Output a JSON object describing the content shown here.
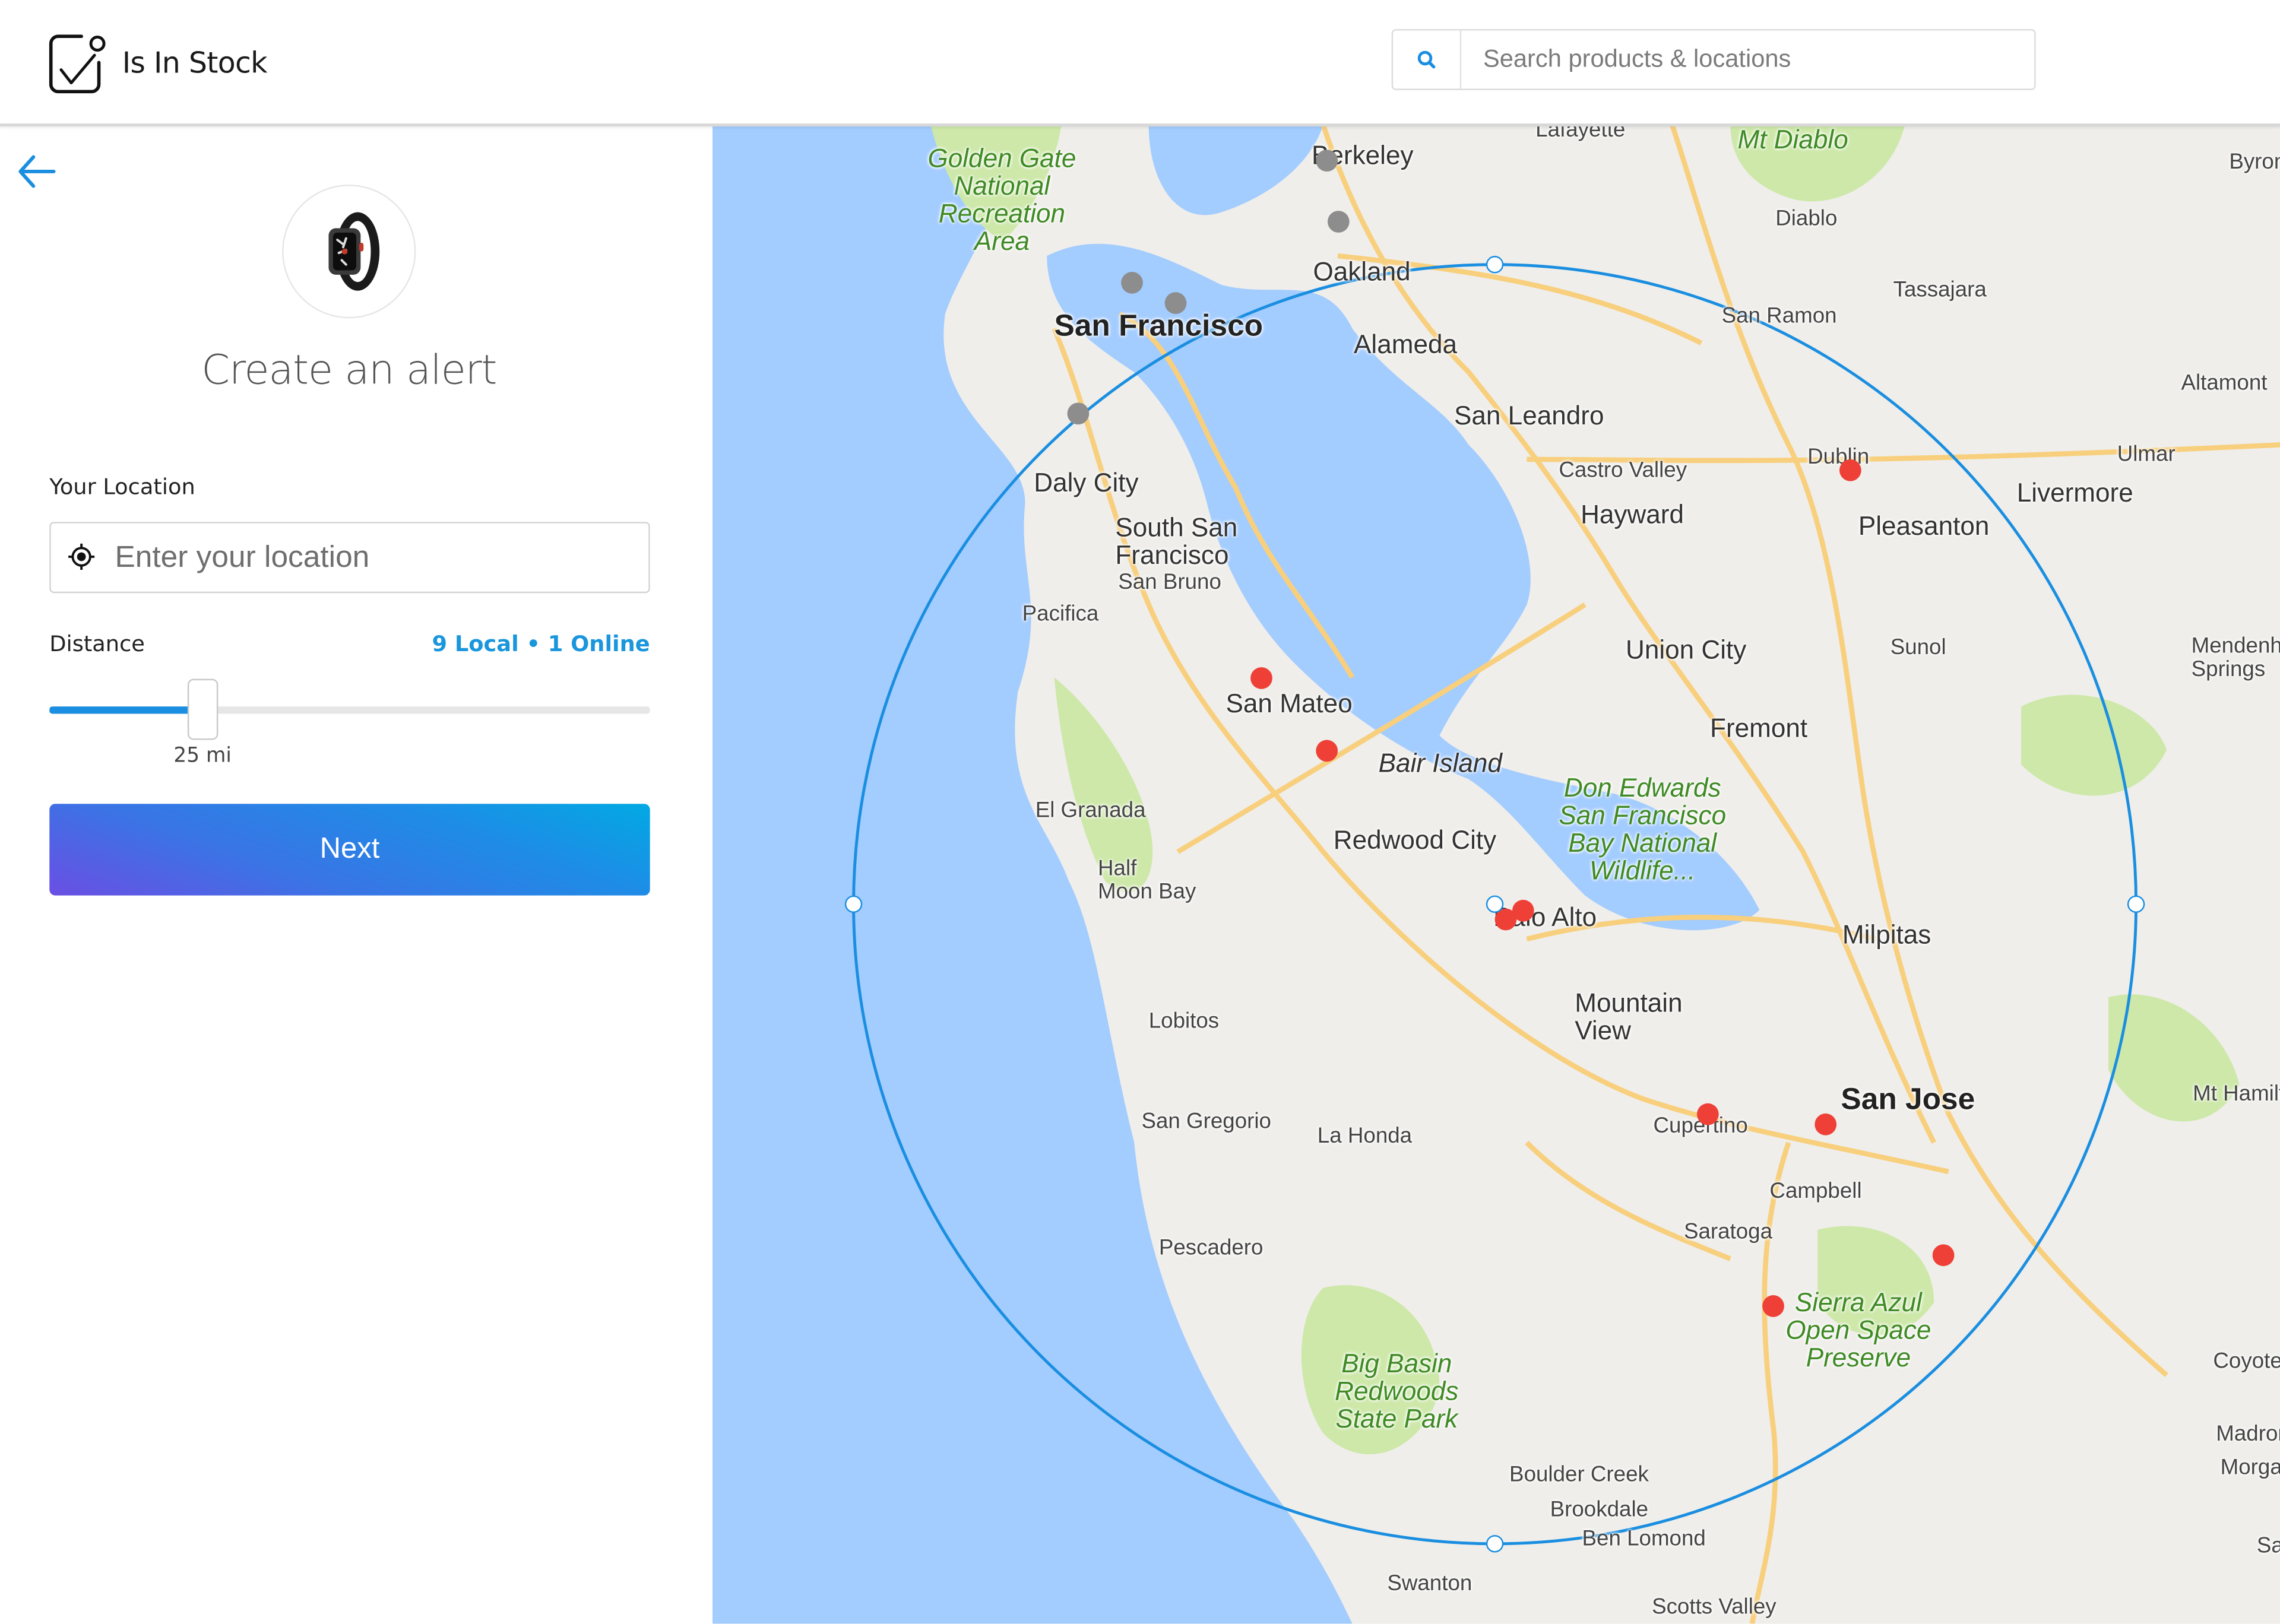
{
  "header": {
    "brand": "Is In Stock",
    "search": {
      "placeholder": "Search products & locations",
      "value": ""
    }
  },
  "sidebar": {
    "product_image": "apple-watch-black",
    "title": "Create an alert",
    "location_label": "Your Location",
    "location_placeholder": "Enter your location",
    "location_value": "",
    "distance_label": "Distance",
    "result_counts": "9 Local • 1 Online",
    "distance": {
      "value": 25,
      "unit": "mi",
      "display": "25 mi",
      "fill_fraction": 0.255
    },
    "next_label": "Next"
  },
  "colors": {
    "accent": "#1a8ee0",
    "counts_text": "#1a96dc",
    "in_stock_marker": "#ee4037",
    "other_marker": "#8d8d8d",
    "water": "#a3ccff",
    "land": "#efeeea",
    "park": "#cde8a8",
    "road": "#f8cf7d"
  },
  "map": {
    "radius_miles": 25,
    "labels": [
      {
        "text": "Golden Gate\nNational\nRecreation\nArea",
        "kind": "park"
      },
      {
        "text": "Berkeley",
        "kind": "med"
      },
      {
        "text": "Lafayette",
        "kind": "sm"
      },
      {
        "text": "Mt Diablo",
        "kind": "park"
      },
      {
        "text": "Byron",
        "kind": "sm"
      },
      {
        "text": "Diablo",
        "kind": "sm"
      },
      {
        "text": "Oakland",
        "kind": "med"
      },
      {
        "text": "Tassajara",
        "kind": "sm"
      },
      {
        "text": "San Francisco",
        "kind": "big"
      },
      {
        "text": "Alameda",
        "kind": "med"
      },
      {
        "text": "San Ramon",
        "kind": "sm"
      },
      {
        "text": "Altamont",
        "kind": "sm"
      },
      {
        "text": "San Leandro",
        "kind": "med"
      },
      {
        "text": "Dublin",
        "kind": "sm"
      },
      {
        "text": "Ulmar",
        "kind": "sm"
      },
      {
        "text": "Daly City",
        "kind": "med"
      },
      {
        "text": "Castro Valley",
        "kind": "sm"
      },
      {
        "text": "Livermore",
        "kind": "med"
      },
      {
        "text": "South San\nFrancisco",
        "kind": "med"
      },
      {
        "text": "Hayward",
        "kind": "med"
      },
      {
        "text": "Pleasanton",
        "kind": "med"
      },
      {
        "text": "San Bruno",
        "kind": "sm"
      },
      {
        "text": "Pacifica",
        "kind": "sm"
      },
      {
        "text": "Union City",
        "kind": "med"
      },
      {
        "text": "Sunol",
        "kind": "sm"
      },
      {
        "text": "Mendenhall\nSprings",
        "kind": "sm"
      },
      {
        "text": "San Mateo",
        "kind": "med"
      },
      {
        "text": "Fremont",
        "kind": "med"
      },
      {
        "text": "Bair Island",
        "kind": "park-grey"
      },
      {
        "text": "Don Edwards\nSan Francisco\nBay National\nWildlife...",
        "kind": "park"
      },
      {
        "text": "El Granada",
        "kind": "sm"
      },
      {
        "text": "Redwood City",
        "kind": "med"
      },
      {
        "text": "Half\nMoon Bay",
        "kind": "sm"
      },
      {
        "text": "Palo Alto",
        "kind": "med"
      },
      {
        "text": "Milpitas",
        "kind": "med"
      },
      {
        "text": "Mountain\nView",
        "kind": "med"
      },
      {
        "text": "Lobitos",
        "kind": "sm"
      },
      {
        "text": "Mt Hamilton",
        "kind": "sm"
      },
      {
        "text": "San Jose",
        "kind": "big"
      },
      {
        "text": "San Gregorio",
        "kind": "sm"
      },
      {
        "text": "La Honda",
        "kind": "sm"
      },
      {
        "text": "Cupertino",
        "kind": "sm"
      },
      {
        "text": "Campbell",
        "kind": "sm"
      },
      {
        "text": "Saratoga",
        "kind": "sm"
      },
      {
        "text": "Pescadero",
        "kind": "sm"
      },
      {
        "text": "Sierra Azul\nOpen Space\nPreserve",
        "kind": "park"
      },
      {
        "text": "Coyote",
        "kind": "sm"
      },
      {
        "text": "Big Basin\nRedwoods\nState Park",
        "kind": "park"
      },
      {
        "text": "Madrone",
        "kind": "sm"
      },
      {
        "text": "Morgan Hill",
        "kind": "sm"
      },
      {
        "text": "Boulder Creek",
        "kind": "sm"
      },
      {
        "text": "Brookdale",
        "kind": "sm"
      },
      {
        "text": "Ben Lomond",
        "kind": "sm"
      },
      {
        "text": "San Martin",
        "kind": "sm"
      },
      {
        "text": "Swanton",
        "kind": "sm"
      },
      {
        "text": "Scotts Valley",
        "kind": "sm"
      }
    ],
    "markers_in_stock_count": 9,
    "markers_other_count": 5
  }
}
